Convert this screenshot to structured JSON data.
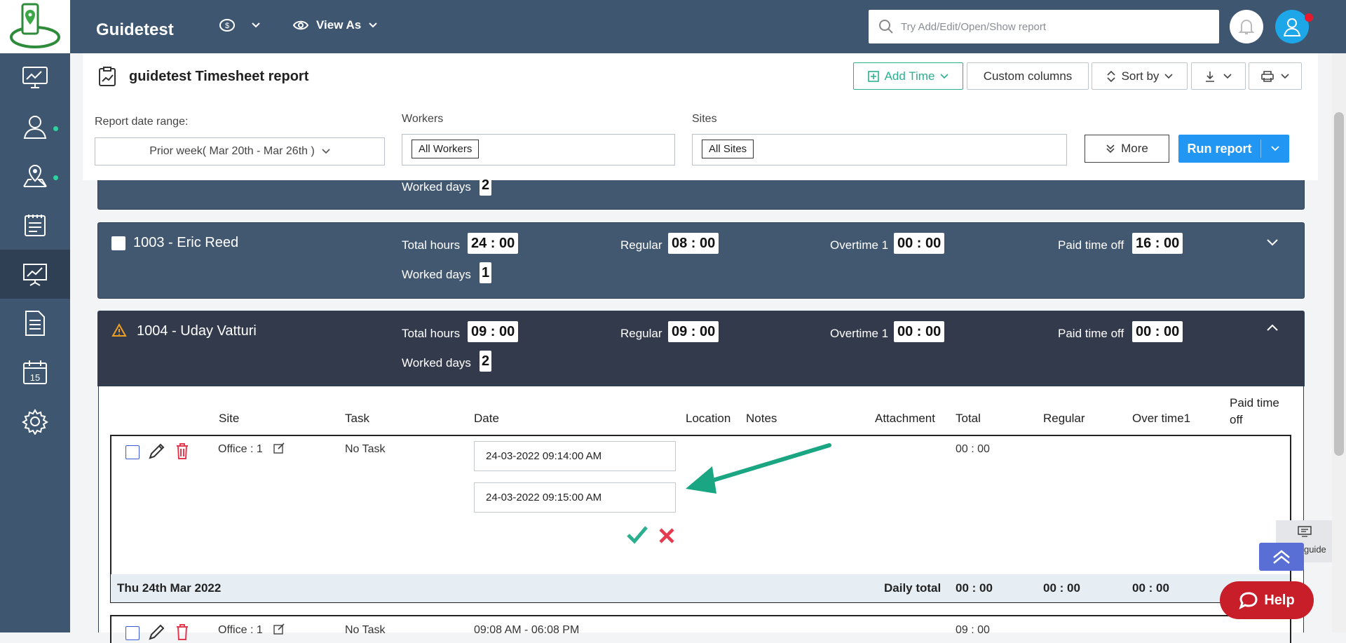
{
  "app": {
    "brand": "Guidetest"
  },
  "topbar": {
    "view_as_label": "View As",
    "search_placeholder": "Try Add/Edit/Open/Show report"
  },
  "report": {
    "title": "guidetest Timesheet report",
    "add_time_label": "Add Time",
    "custom_columns_label": "Custom columns",
    "sort_by_label": "Sort by"
  },
  "filters": {
    "date_range_label": "Report date range:",
    "date_range_value": "Prior week( Mar 20th - Mar 26th )",
    "workers_label": "Workers",
    "workers_tag": "All Workers",
    "sites_label": "Sites",
    "sites_tag": "All Sites",
    "more_label": "More",
    "run_label": "Run report"
  },
  "cards": {
    "prev": {
      "worked_days_label": "Worked days",
      "worked_days": "2"
    },
    "eric": {
      "name": "1003 - Eric Reed",
      "total_hours_label": "Total hours",
      "total_hours": "24 : 00",
      "regular_label": "Regular",
      "regular": "08 : 00",
      "overtime_label": "Overtime 1",
      "overtime": "00 : 00",
      "pto_label": "Paid time off",
      "pto": "16 : 00",
      "worked_days_label": "Worked days",
      "worked_days": "1"
    },
    "uday": {
      "name": "1004 - Uday Vatturi",
      "total_hours_label": "Total hours",
      "total_hours": "09 : 00",
      "regular_label": "Regular",
      "regular": "09 : 00",
      "overtime_label": "Overtime 1",
      "overtime": "00 : 00",
      "pto_label": "Paid time off",
      "pto": "00 : 00",
      "worked_days_label": "Worked days",
      "worked_days": "2"
    }
  },
  "table": {
    "headers": {
      "site": "Site",
      "task": "Task",
      "date": "Date",
      "location": "Location",
      "notes": "Notes",
      "attachment": "Attachment",
      "total": "Total",
      "regular": "Regular",
      "overtime": "Over time1",
      "pto": "Paid time off"
    },
    "row1": {
      "site": "Office : 1",
      "task": "No Task",
      "start": "24-03-2022 09:14:00 AM",
      "end": "24-03-2022 09:15:00 AM",
      "total": "00 : 00"
    },
    "summary": {
      "date": "Thu 24th Mar 2022",
      "daily_total_label": "Daily total",
      "total": "00 : 00",
      "regular": "00 : 00",
      "overtime": "00 : 00"
    },
    "row2": {
      "site": "Office : 1",
      "task": "No Task",
      "time": "09:08 AM - 06:08 PM",
      "total": "09 : 00"
    }
  },
  "floating": {
    "page_guide": "Page guide",
    "help": "Help"
  },
  "colors": {
    "sidebar": "#3f5670",
    "accent": "#2196f3",
    "teal": "#2bb08f",
    "danger": "#e53950"
  }
}
